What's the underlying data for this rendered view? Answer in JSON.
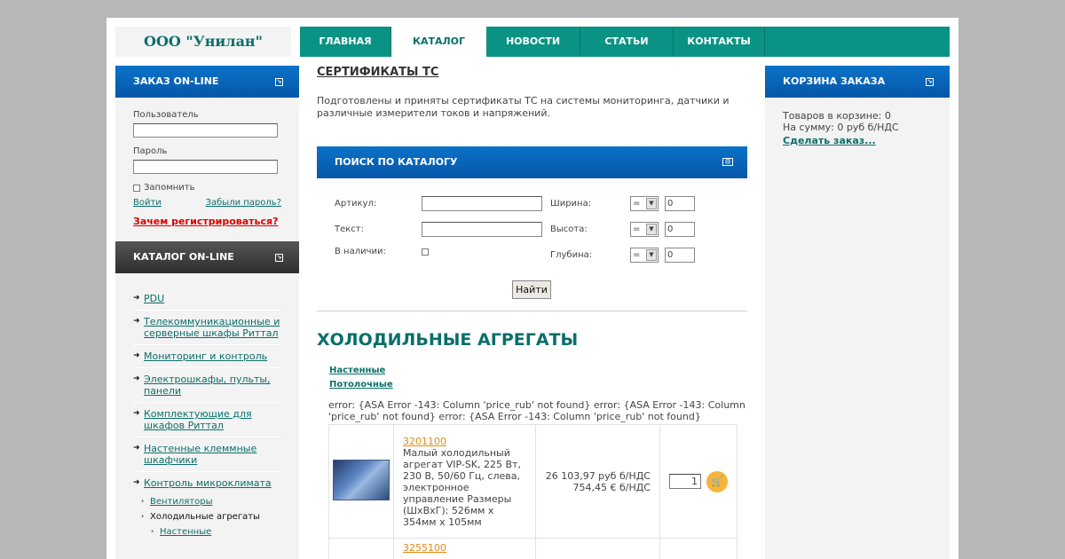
{
  "logo": "ООО \"Унилан\"",
  "nav": [
    {
      "label": "ГЛАВНАЯ"
    },
    {
      "label": "КАТАЛОГ"
    },
    {
      "label": "НОВОСТИ"
    },
    {
      "label": "СТАТЬИ"
    },
    {
      "label": "КОНТАКТЫ"
    }
  ],
  "order_box": {
    "title": "ЗАКАЗ ON-LINE",
    "user_label": "Пользователь",
    "password_label": "Пароль",
    "remember_label": "Запомнить",
    "login_link": "Войти",
    "forgot_link": "Забыли пароль?",
    "why_register": "Зачем регистрироваться?"
  },
  "catalog_box": {
    "title": "КАТАЛОГ ON-LINE",
    "items": [
      "PDU",
      "Телекоммуникационные и серверные шкафы Риттал",
      "Мониторинг и контроль",
      "Электрошкафы, пульты, панели",
      "Комплектующие для шкафов Риттал",
      "Настенные клеммные шкафчики",
      "Контроль микроклимата"
    ],
    "sub_items": [
      "Вентиляторы",
      "Холодильные агрегаты"
    ],
    "sub_sub_items": [
      "Настенные"
    ]
  },
  "cert": {
    "title": "СЕРТИФИКАТЫ ТС",
    "text": "Подготовлены и приняты сертификаты ТС на системы мониторинга, датчики и различные измерители токов и напряжений."
  },
  "search": {
    "title": "ПОИСК ПО КАТАЛОГУ",
    "article_label": "Артикул:",
    "text_label": "Текст:",
    "stock_label": "В наличии:",
    "width_label": "Ширина:",
    "height_label": "Высота:",
    "depth_label": "Глубина:",
    "op": "=",
    "default_value": "0",
    "find_button": "Найти"
  },
  "section": {
    "title": "ХОЛОДИЛЬНЫЕ АГРЕГАТЫ",
    "links": [
      "Настенные",
      "Потолочные"
    ],
    "error": "error: {ASA Error -143: Column 'price_rub' not found} error: {ASA Error -143: Column 'price_rub' not found} error: {ASA Error -143: Column 'price_rub' not found}"
  },
  "products": [
    {
      "code": "3201100",
      "description": "Малый холодильный агрегат VIP-SK, 225 Вт, 230 В, 50/60 Гц, слева, электронное управление Размеры (ШxВxГ): 526мм x 354мм x 105мм",
      "price_rub": "26 103,97 руб б/НДС",
      "price_eur": "754,45 € б/НДС",
      "qty": "1"
    },
    {
      "code": "3255100"
    }
  ],
  "cart_box": {
    "title": "КОРЗИНА ЗАКАЗА",
    "items_line": "Товаров в корзине: 0",
    "sum_line": "На сумму: 0 руб б/НДС",
    "order_link": "Сделать заказ..."
  }
}
